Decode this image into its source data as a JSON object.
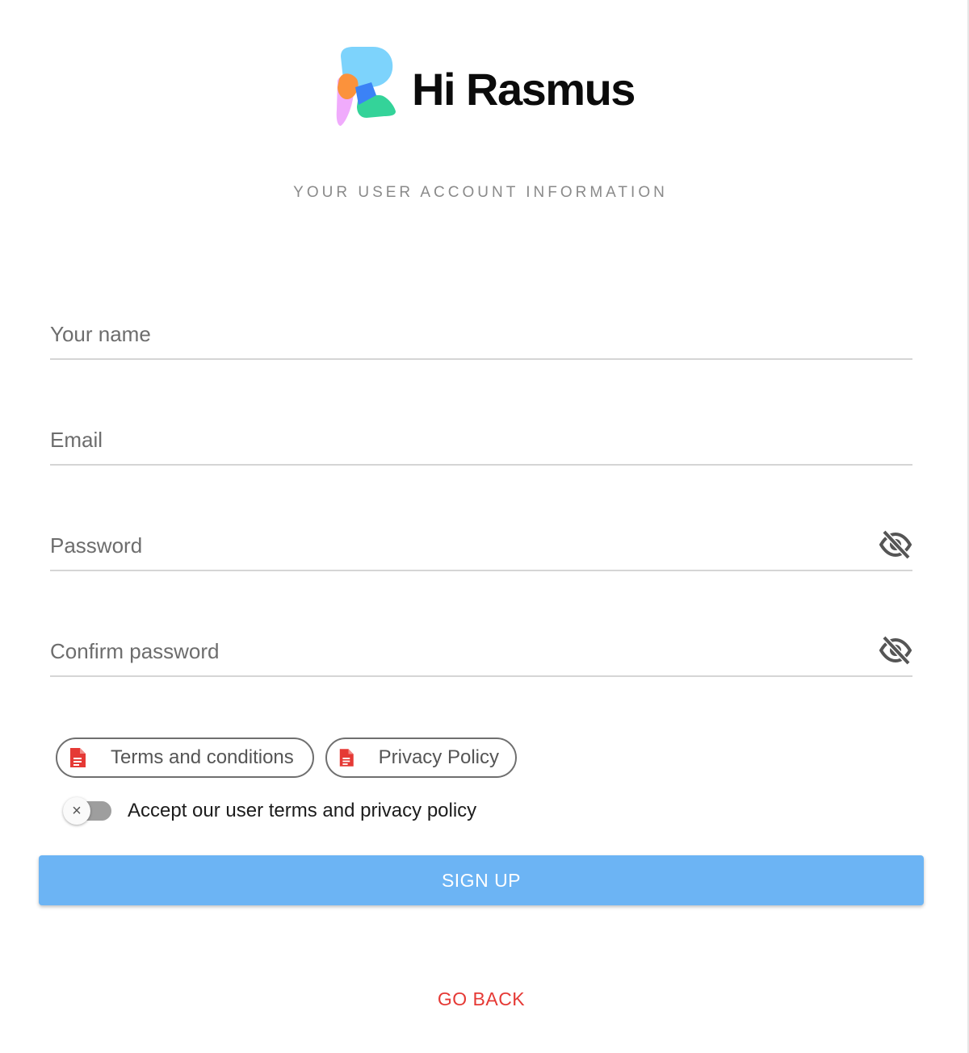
{
  "brand": {
    "name": "Hi Rasmus",
    "logo_icon": "rasmus-logo-mark",
    "logo_colors": [
      "#7dd3fc",
      "#fb923c",
      "#f0abfc",
      "#3b82f6",
      "#34d399"
    ]
  },
  "page": {
    "subtitle": "YOUR USER ACCOUNT INFORMATION"
  },
  "form": {
    "name": {
      "placeholder": "Your name",
      "value": ""
    },
    "email": {
      "placeholder": "Email",
      "value": ""
    },
    "password": {
      "placeholder": "Password",
      "value": "",
      "visibility_icon": "eye-off-icon"
    },
    "confirm_password": {
      "placeholder": "Confirm password",
      "value": "",
      "visibility_icon": "eye-off-icon"
    }
  },
  "documents": {
    "terms": {
      "label": "Terms and conditions",
      "icon": "document-icon"
    },
    "privacy": {
      "label": "Privacy Policy",
      "icon": "document-icon"
    },
    "icon_color": "#e53935"
  },
  "consent": {
    "label": "Accept our user terms and privacy policy",
    "checked": false,
    "thumb_symbol": "×"
  },
  "actions": {
    "signup_label": "SIGN UP",
    "signup_color": "#6cb4f4",
    "goback_label": "GO BACK",
    "goback_color": "#e53935"
  }
}
